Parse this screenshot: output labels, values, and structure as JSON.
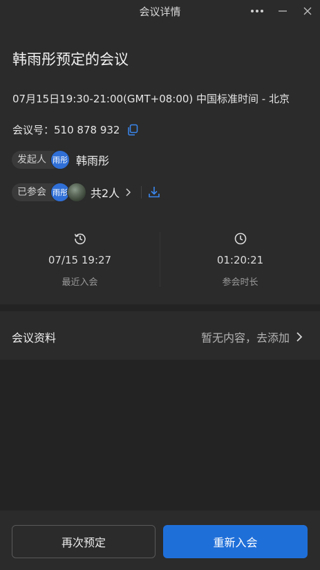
{
  "window": {
    "title": "会议详情"
  },
  "meeting": {
    "title": "韩雨彤预定的会议",
    "time": "07月15日19:30-21:00(GMT+08:00) 中国标准时间 - 北京",
    "id_label": "会议号：",
    "id_value": "510 878 932"
  },
  "organizer": {
    "tag": "发起人",
    "avatar_text": "雨彤",
    "name": "韩雨彤"
  },
  "participants": {
    "tag": "已参会",
    "avatar_text": "雨彤",
    "count_text": "共2人"
  },
  "stats": {
    "last_join": {
      "value": "07/15 19:27",
      "label": "最近入会"
    },
    "duration": {
      "value": "01:20:21",
      "label": "参会时长"
    }
  },
  "docs": {
    "label": "会议资料",
    "action": "暂无内容，去添加"
  },
  "footer": {
    "rebook_label": "再次预定",
    "rejoin_label": "重新入会"
  },
  "colors": {
    "background": "#232323",
    "panel": "#2b2b2b",
    "accent": "#1f6fd9",
    "avatar": "#2f6fd6"
  },
  "icons": [
    "more-icon",
    "minimize-icon",
    "close-icon",
    "copy-icon",
    "chevron-right-icon",
    "download-icon",
    "history-icon",
    "clock-icon"
  ]
}
